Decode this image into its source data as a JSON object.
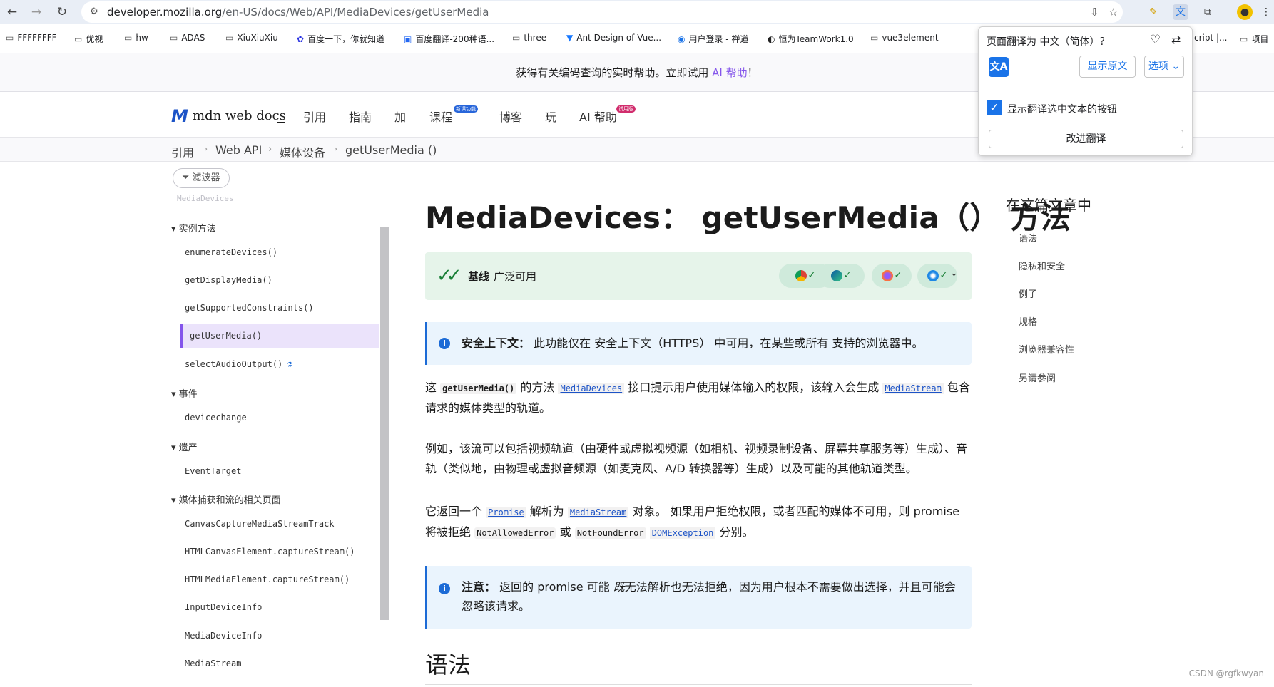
{
  "browser": {
    "url_host": "developer.mozilla.org",
    "url_path": "/en-US/docs/Web/API/MediaDevices/getUserMedia",
    "bookmarks": [
      {
        "label": "FFFFFFFF",
        "icon": "folder-icon"
      },
      {
        "label": "优视",
        "icon": "folder-icon"
      },
      {
        "label": "hw",
        "icon": "folder-icon"
      },
      {
        "label": "ADAS",
        "icon": "folder-icon"
      },
      {
        "label": "XiuXiuXiu",
        "icon": "folder-icon"
      },
      {
        "label": "百度一下，你就知道",
        "icon": "baidu-icon"
      },
      {
        "label": "百度翻译-200种语...",
        "icon": "baidu-translate-icon"
      },
      {
        "label": "three",
        "icon": "folder-icon"
      },
      {
        "label": "Ant Design of Vue...",
        "icon": "antd-icon"
      },
      {
        "label": "用户登录 - 禅道",
        "icon": "zentao-icon"
      },
      {
        "label": "恒为TeamWork1.0",
        "icon": "teamwork-icon"
      },
      {
        "label": "vue3element",
        "icon": "folder-icon"
      },
      {
        "label": "cript |...",
        "icon": "folder-icon"
      },
      {
        "label": "项目",
        "icon": "folder-icon"
      }
    ]
  },
  "banner": {
    "text": "获得有关编码查询的实时帮助。立即试用 ",
    "link": "AI 帮助",
    "suffix": "！"
  },
  "header": {
    "logo": "mdn web docs",
    "nav": [
      "引用",
      "指南",
      "加",
      "课程",
      "博客",
      "玩",
      "AI 帮助"
    ],
    "course_badge": "新课功能",
    "ai_badge": "试用版"
  },
  "breadcrumb": [
    "引用",
    "Web API",
    "媒体设备",
    "getUserMedia ()"
  ],
  "sidebar": {
    "filter_label": "滤波器",
    "faded_item": "MediaDevices",
    "sections": [
      {
        "title": "实例方法",
        "items": [
          "enumerateDevices()",
          "getDisplayMedia()",
          "getSupportedConstraints()",
          "getUserMedia()",
          "selectAudioOutput()"
        ]
      },
      {
        "title": "事件",
        "items": [
          "devicechange"
        ]
      },
      {
        "title": "遗产",
        "items": [
          "EventTarget"
        ]
      },
      {
        "title": "媒体捕获和流的相关页面",
        "items": [
          "CanvasCaptureMediaStreamTrack",
          "HTMLCanvasElement.captureStream()",
          "HTMLMediaElement.captureStream()",
          "InputDeviceInfo",
          "MediaDeviceInfo",
          "MediaStream"
        ]
      }
    ]
  },
  "main": {
    "title": "MediaDevices： getUserMedia（） 方法",
    "baseline_bold": "基线",
    "baseline_text": "广泛可用",
    "secure_note_bold": "安全上下文：",
    "secure_note_pre": "此功能仅在",
    "secure_note_link1": "安全上下文",
    "secure_note_mid": "（HTTPS） 中可用，在某些或所有",
    "secure_note_link2": "支持的浏览器",
    "secure_note_post": "中。",
    "p1_a": "这",
    "p1_code": "getUserMedia()",
    "p1_b": "的方法",
    "p1_link1": "MediaDevices",
    "p1_c": "接口提示用户使用媒体输入的权限，该输入会生成",
    "p1_link2": "MediaStream",
    "p1_d": "包含请求的媒体类型的轨道。",
    "p2": "例如，该流可以包括视频轨道（由硬件或虚拟视频源（如相机、视频录制设备、屏幕共享服务等）生成）、音轨（类似地，由物理或虚拟音频源（如麦克风、A/D 转换器等）生成）以及可能的其他轨道类型。",
    "p3_a": "它返回一个",
    "p3_link1": "Promise",
    "p3_b": "解析为",
    "p3_link2": "MediaStream",
    "p3_c": "对象。 如果用户拒绝权限，或者匹配的媒体不可用，则 promise 将被拒绝",
    "p3_code1": "NotAllowedError",
    "p3_d": "或",
    "p3_code2": "NotFoundError",
    "p3_link3": "DOMException",
    "p3_e": "分别。",
    "note2_bold": "注意：",
    "note2_a": "返回的 promise 可能",
    "note2_em": "既",
    "note2_b": "无法解析也无法拒绝，因为用户根本不需要做出选择，并且可能会忽略该请求。",
    "h2": "语法"
  },
  "toc": {
    "title": "在这篇文章中",
    "items": [
      "语法",
      "隐私和安全",
      "例子",
      "规格",
      "浏览器兼容性",
      "另请参阅"
    ]
  },
  "translate_popup": {
    "title": "页面翻译为 中文（简体）？",
    "show_original": "显示原文",
    "options": "选项",
    "checkbox_label": "显示翻译选中文本的按钮",
    "improve": "改进翻译"
  },
  "watermark": "CSDN @rgfkwyan",
  "colors": {
    "accent": "#8455eb",
    "link": "#1c53c7",
    "baseline_bg": "#e6f4ea",
    "note_bg": "#eaf4fd"
  }
}
